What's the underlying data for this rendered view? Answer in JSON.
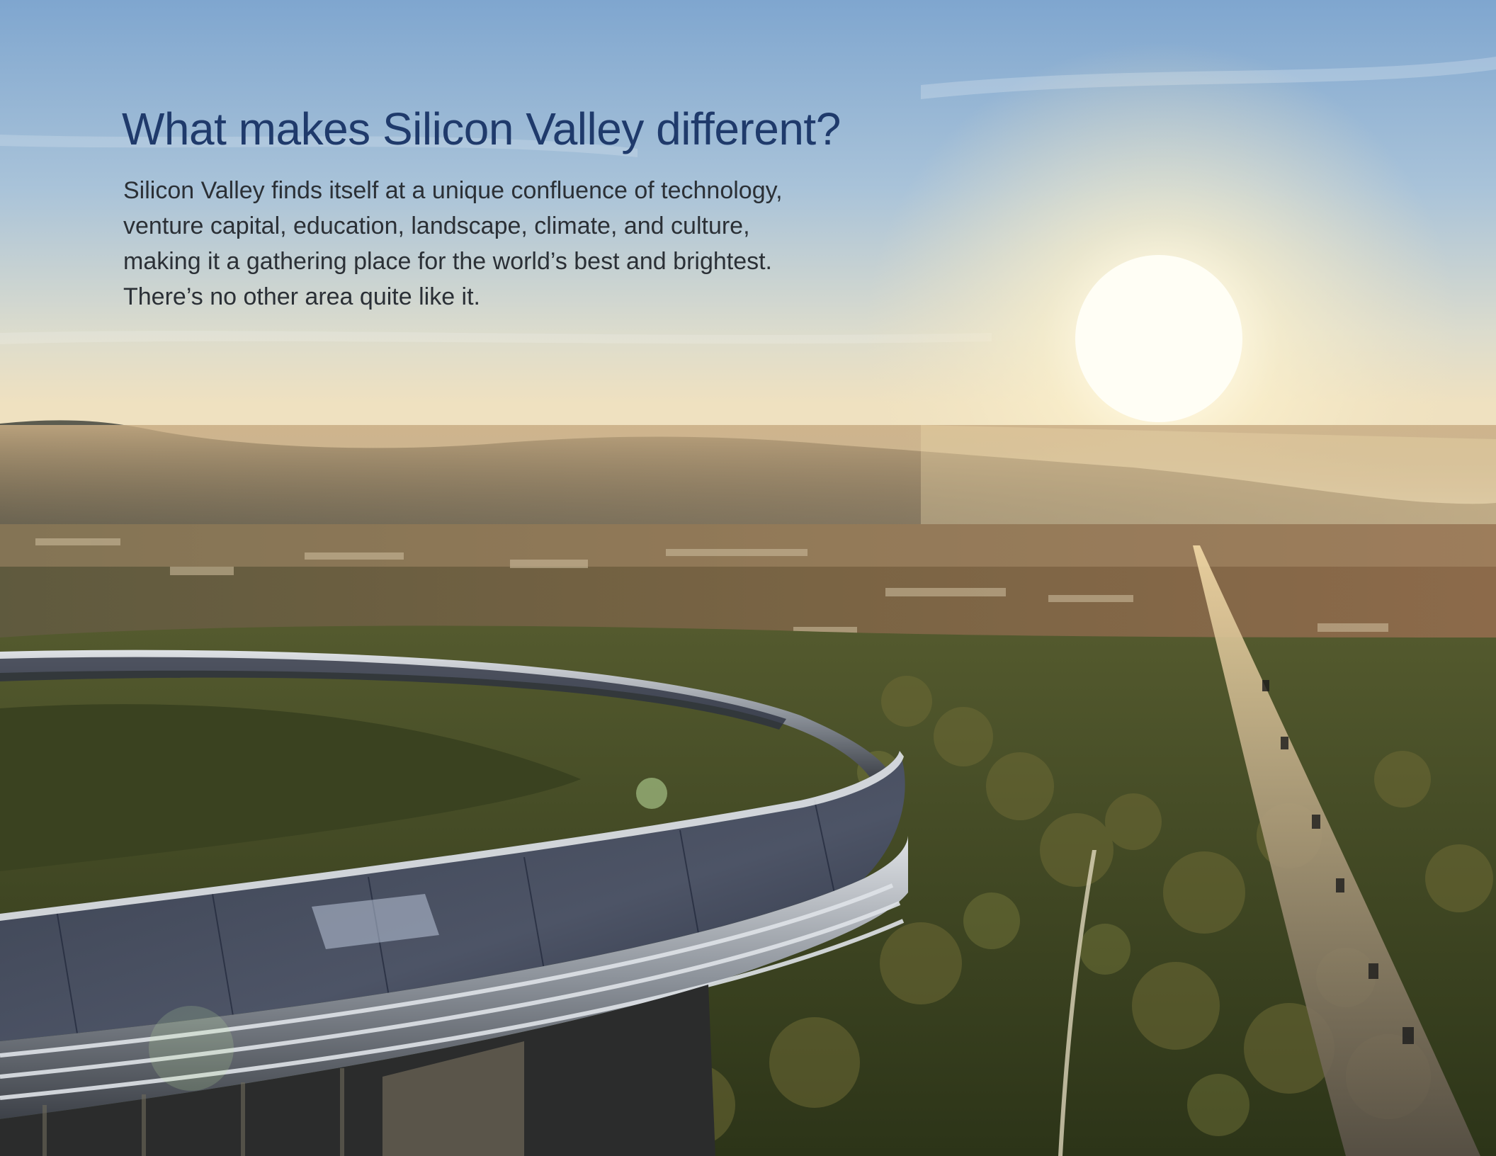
{
  "headline": "What makes Silicon Valley different?",
  "body_lines": [
    "Silicon Valley finds itself at a unique confluence of technology,",
    "venture capital, education, landscape, climate, and culture,",
    "making it a gathering place for the world’s best and brightest.",
    "There’s no other area quite like it."
  ],
  "colors": {
    "headline": "#1f3a6b",
    "body_text": "#2b3036",
    "sky_top": "#7fa9d3",
    "sky_horizon": "#e9e3cf",
    "sun": "#fffbe6"
  }
}
